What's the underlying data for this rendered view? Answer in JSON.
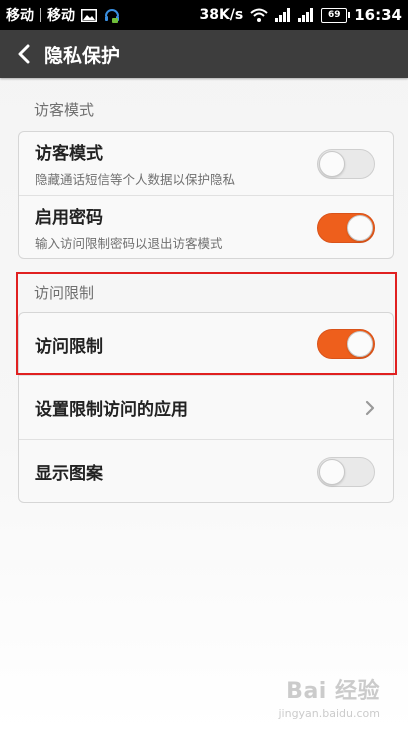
{
  "status_bar": {
    "carrier1": "移动",
    "carrier2": "移动",
    "speed": "38K/s",
    "battery": "69",
    "time": "16:34"
  },
  "header": {
    "title": "隐私保护"
  },
  "guest_section": {
    "header": "访客模式",
    "items": [
      {
        "title": "访客模式",
        "subtitle": "隐藏通话短信等个人数据以保护隐私",
        "toggle": "off"
      },
      {
        "title": "启用密码",
        "subtitle": "输入访问限制密码以退出访客模式",
        "toggle": "on"
      }
    ]
  },
  "access_section": {
    "header": "访问限制",
    "items": [
      {
        "title": "访问限制",
        "toggle": "on"
      },
      {
        "title": "设置限制访问的应用"
      },
      {
        "title": "显示图案",
        "toggle": "off"
      }
    ]
  },
  "colors": {
    "accent": "#ee5f1c",
    "title_bar": "#3d3d3d",
    "highlight": "#e02020"
  },
  "watermark": {
    "main": "Bai  经验",
    "sub": "jingyan.baidu.com"
  }
}
